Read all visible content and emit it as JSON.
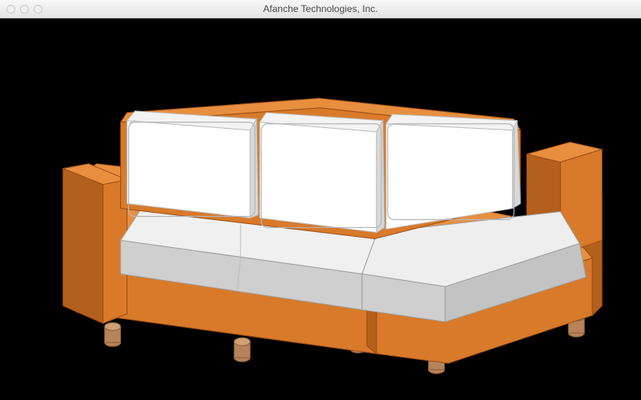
{
  "window": {
    "title": "Afanche Technologies, Inc."
  },
  "viewport": {
    "background_color": "#000000",
    "model_name": "sectional-sofa",
    "colors": {
      "frame": "#d87a2a",
      "frame_shade": "#b55f1c",
      "frame_light": "#e88f3f",
      "cushion_top": "#f4f4f4",
      "cushion_side": "#cfcfcf",
      "cushion_edge": "#9e9e9e",
      "back_cushion": "#ffffff",
      "leg": "#b7835a",
      "leg_dark": "#8a5d38"
    }
  }
}
